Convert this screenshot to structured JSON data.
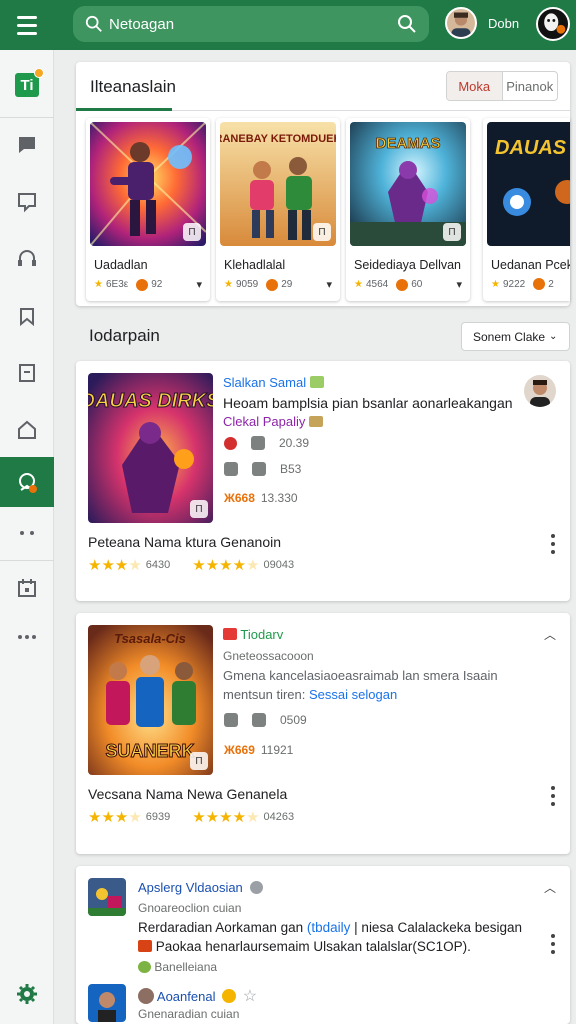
{
  "header": {
    "search_value": "Netoagan",
    "user_name": "Dobn"
  },
  "colors": {
    "brand": "#1f7a45",
    "accent_orange": "#e8710a",
    "star": "#f4b400",
    "link_blue": "#1a73e8"
  },
  "sidebar": {
    "items": [
      {
        "icon": "app-logo-icon",
        "logo_text": "Ti"
      },
      {
        "icon": "chat-icon"
      },
      {
        "icon": "message-icon"
      },
      {
        "icon": "headset-icon"
      },
      {
        "icon": "bookmark-icon"
      },
      {
        "icon": "note-icon"
      },
      {
        "icon": "home-icon"
      },
      {
        "icon": "achievement-icon",
        "active": true
      },
      {
        "icon": "dots-icon"
      },
      {
        "icon": "calendar-icon"
      },
      {
        "icon": "more-icon"
      },
      {
        "icon": "settings-icon"
      }
    ]
  },
  "featured": {
    "title": "Ilteanaslain",
    "toggle": {
      "active": "Moka",
      "inactive": "Pinanok"
    },
    "games": [
      {
        "name": "Uadadlan",
        "stat1": "6E3ε",
        "stat2": "92",
        "art_title": ""
      },
      {
        "name": "Klehadlalal",
        "stat1": "9059",
        "stat2": "29",
        "art_title": "RANEBAY KETOMDUEH"
      },
      {
        "name": "Seidediaya Dellvan",
        "stat1": "4564",
        "stat2": "60",
        "art_title": "DEAMAS"
      },
      {
        "name": "Uedanan Pcek",
        "stat1": "9222",
        "stat2": "2",
        "art_title": "DAUAS MORREN"
      }
    ],
    "badge": "Π"
  },
  "feed": {
    "title": "Iodarpain",
    "sort_label": "Sonem Clake",
    "posts": [
      {
        "thumb_title": "DAUAS DIRKS",
        "author": "Slalkan Samal",
        "headline": "Heoam bamplsia pian bsanlar aonarleakangan",
        "tag": "Clekal Papaliy",
        "stat1": "20.39",
        "stat2": "B53",
        "score_label": "Ж668",
        "score_value": "13.330",
        "name": "Peteana Nama ktura Genanoin",
        "rating1": "6430",
        "rating2": "09043"
      },
      {
        "thumb_title": "Tsasala-Cis",
        "thumb_title2": "SUANERK",
        "author": "Tiodarv",
        "sub": "Gneteossacooon",
        "desc1": "Gmena kancelasiaoeasraimab lan smera Isaain",
        "desc2a": "mentsun tiren:",
        "desc2b": "Sessai selogan",
        "stat1": "0509",
        "score_label": "Ж669",
        "score_value": "11921",
        "name": "Vecsana Nama Newa Genanela",
        "rating1": "6939",
        "rating2": "04263"
      },
      {
        "author": "Apslerg Vldaosian",
        "sub": "Gnoareoclion cuian",
        "line1a": "Rerdaradian Aorkaman gan",
        "line1b": "(tbdaily",
        "line1c": "| niesa Calalackeka besigan",
        "line2": "Paokaa henarlaursemaim Ulsakan talalslar(SC1OP).",
        "tag": "Banelleiana",
        "reply_author": "Aoanfenal",
        "reply_sub": "Gnenaradian cuian"
      }
    ]
  }
}
